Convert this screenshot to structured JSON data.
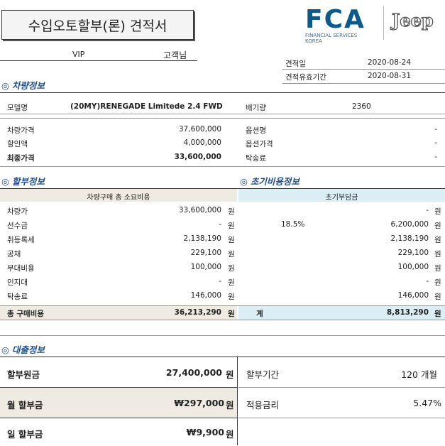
{
  "header": {
    "title": "수입오토할부(론) 견적서",
    "customer_name": "VIP",
    "customer_suffix": "고객님",
    "quote_date_label": "견적일",
    "quote_date": "2020-08-24",
    "valid_until_label": "견적유효기간",
    "valid_until": "2020-08-31",
    "brand_fca": "FCA",
    "brand_fca_sub1": "FINANCIAL SERVICES",
    "brand_fca_sub2": "KOREA",
    "brand_jeep": "Jeep"
  },
  "vehicle": {
    "section_title": "차량정보",
    "model_label": "모델명",
    "model_value": "(20MY)RENEGADE Limitede 2.4 FWD",
    "displacement_label": "배기량",
    "displacement_value": "2360",
    "price_label": "차량가격",
    "price_value": "37,600,000",
    "discount_label": "할인액",
    "discount_value": "4,000,000",
    "final_label": "최종가격",
    "final_value": "33,600,000",
    "option_name_label": "옵션명",
    "option_name_value": "-",
    "option_price_label": "옵션가격",
    "option_price_value": "-",
    "delivery_label": "탁송료",
    "delivery_value": "-"
  },
  "installment": {
    "section_title": "할부정보",
    "initial_section_title": "초기비용정보",
    "total_header": "차량구매 총 소요비용",
    "initial_header": "초기부담금",
    "unit": "원",
    "down_rate": "18.5%",
    "rows": [
      {
        "label": "차량가",
        "total": "33,600,000",
        "initial": "-"
      },
      {
        "label": "선수금",
        "total": "-",
        "initial": "6,200,000"
      },
      {
        "label": "취등록세",
        "total": "2,138,190",
        "initial": "2,138,190"
      },
      {
        "label": "공채",
        "total": "229,100",
        "initial": "229,100"
      },
      {
        "label": "부대비용",
        "total": "100,000",
        "initial": "100,000"
      },
      {
        "label": "인지대",
        "total": "-",
        "initial": "-"
      },
      {
        "label": "탁송료",
        "total": "146,000",
        "initial": "146,000"
      }
    ],
    "total_label": "총 구매비용",
    "total_value": "36,213,290",
    "sum_label": "계",
    "sum_value": "8,813,290"
  },
  "loan": {
    "section_title": "대출정보",
    "principal_label": "할부원금",
    "principal_value": "27,400,000",
    "period_label": "할부기간",
    "period_value": "120 개월",
    "monthly_label": "월 할부금",
    "monthly_value": "₩297,000",
    "rate_label": "적용금리",
    "rate_value": "5.47%",
    "daily_label": "일 할부금",
    "daily_value": "₩9,900",
    "unit": "원"
  }
}
